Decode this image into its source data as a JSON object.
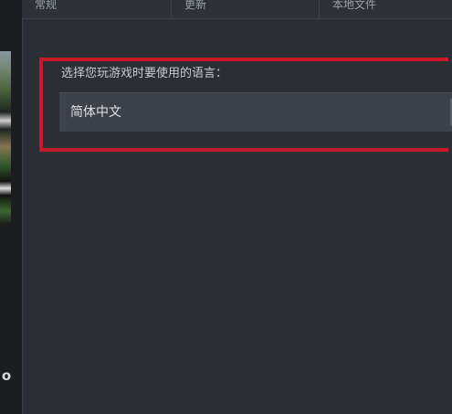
{
  "tabs": [
    {
      "label": "常规"
    },
    {
      "label": "更新"
    },
    {
      "label": "本地文件"
    }
  ],
  "language": {
    "prompt": "选择您玩游戏时要使用的语言：",
    "selected": "简体中文"
  },
  "sidebar": {
    "glyph": "o"
  },
  "colors": {
    "background": "#2b2e34",
    "highlight": "#c8192a",
    "select_bg": "#3d4149"
  }
}
